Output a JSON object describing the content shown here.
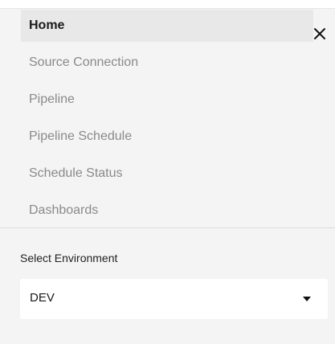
{
  "nav": {
    "items": [
      {
        "label": "Home",
        "active": true
      },
      {
        "label": "Source Connection",
        "active": false
      },
      {
        "label": "Pipeline",
        "active": false
      },
      {
        "label": "Pipeline Schedule",
        "active": false
      },
      {
        "label": "Schedule Status",
        "active": false
      },
      {
        "label": "Dashboards",
        "active": false
      }
    ]
  },
  "environment": {
    "label": "Select Environment",
    "selected": "DEV"
  },
  "icons": {
    "close": "close-icon",
    "dropdown": "caret-down-icon"
  },
  "colors": {
    "panel_bg": "#f4f4f4",
    "active_bg": "#e8e8e8",
    "active_text": "#1a1a1a",
    "inactive_text": "#8a8a8a"
  }
}
